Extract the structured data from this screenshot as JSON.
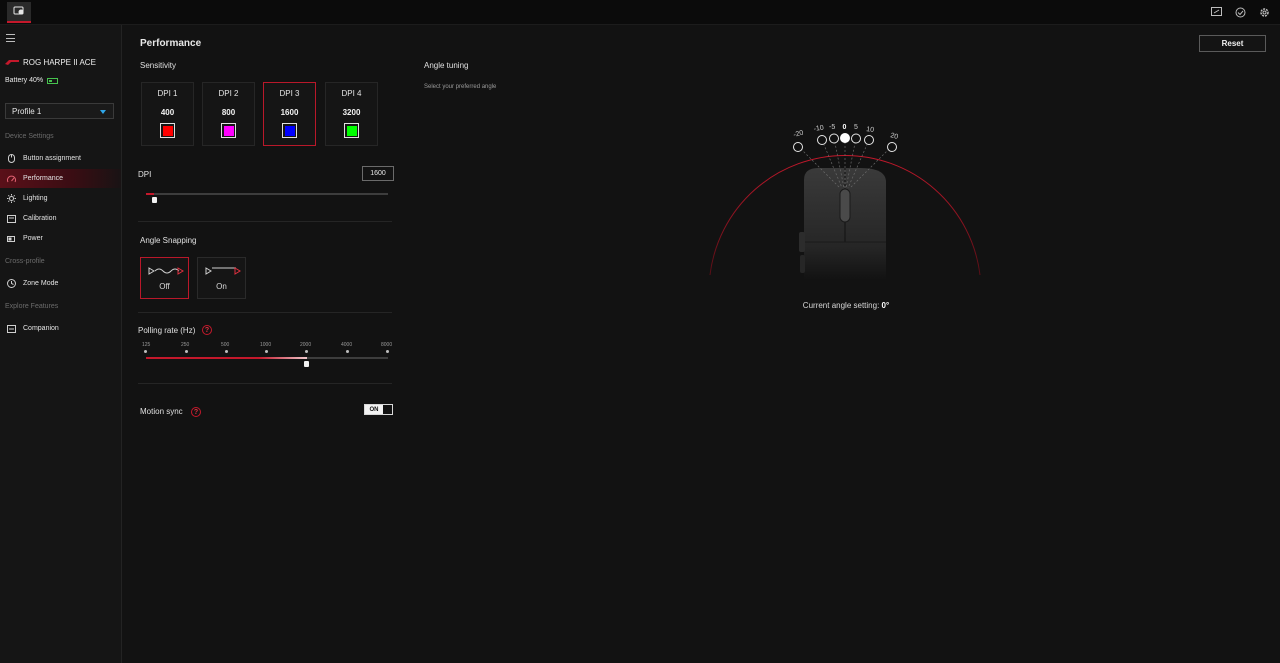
{
  "app": {
    "icon": "mouse-app-icon"
  },
  "top_icons": [
    "display-icon",
    "sync-icon",
    "gear-icon"
  ],
  "sidebar": {
    "device_name": "ROG HARPE II ACE",
    "battery": "Battery 40%",
    "profile": "Profile 1",
    "sections": {
      "device_settings": "Device Settings",
      "cross_profile": "Cross-profile",
      "explore": "Explore Features"
    },
    "items": [
      {
        "label": "Button assignment",
        "icon": "mouse-icon"
      },
      {
        "label": "Performance",
        "icon": "performance-icon"
      },
      {
        "label": "Lighting",
        "icon": "lighting-icon"
      },
      {
        "label": "Calibration",
        "icon": "calibration-icon"
      },
      {
        "label": "Power",
        "icon": "power-icon"
      },
      {
        "label": "Zone Mode",
        "icon": "zone-mode-icon"
      },
      {
        "label": "Companion",
        "icon": "companion-icon"
      }
    ],
    "active_item": "Performance"
  },
  "main": {
    "title": "Performance",
    "reset_label": "Reset",
    "sensitivity_label": "Sensitivity",
    "dpi_stages": [
      {
        "name": "DPI 1",
        "value": "400",
        "color": "#ff0000"
      },
      {
        "name": "DPI 2",
        "value": "800",
        "color": "#ff00ff"
      },
      {
        "name": "DPI 3",
        "value": "1600",
        "color": "#0000ff"
      },
      {
        "name": "DPI 4",
        "value": "3200",
        "color": "#00ff00"
      }
    ],
    "selected_dpi_stage": 3,
    "dpi_label": "DPI",
    "dpi_value": "1600",
    "dpi_slider_fraction": 0.03,
    "angle_snapping_label": "Angle Snapping",
    "angle_snapping_options": [
      "Off",
      "On"
    ],
    "angle_snapping_selected": "Off",
    "polling_label": "Polling rate (Hz)",
    "polling_options": [
      "125",
      "250",
      "500",
      "1000",
      "2000",
      "4000",
      "8000"
    ],
    "polling_selected": "2000",
    "motion_sync_label": "Motion sync",
    "motion_sync_state": "ON",
    "help_glyph": "?"
  },
  "angle_tuning": {
    "title": "Angle tuning",
    "hint": "Select your preferred angle",
    "angles": [
      "-20",
      "-10",
      "-5",
      "0",
      "5",
      "10",
      "20"
    ],
    "selected_angle": "0",
    "current_label": "Current angle setting:",
    "current_value": "0°"
  },
  "colors": {
    "accent": "#c4182b",
    "background": "#121212"
  }
}
